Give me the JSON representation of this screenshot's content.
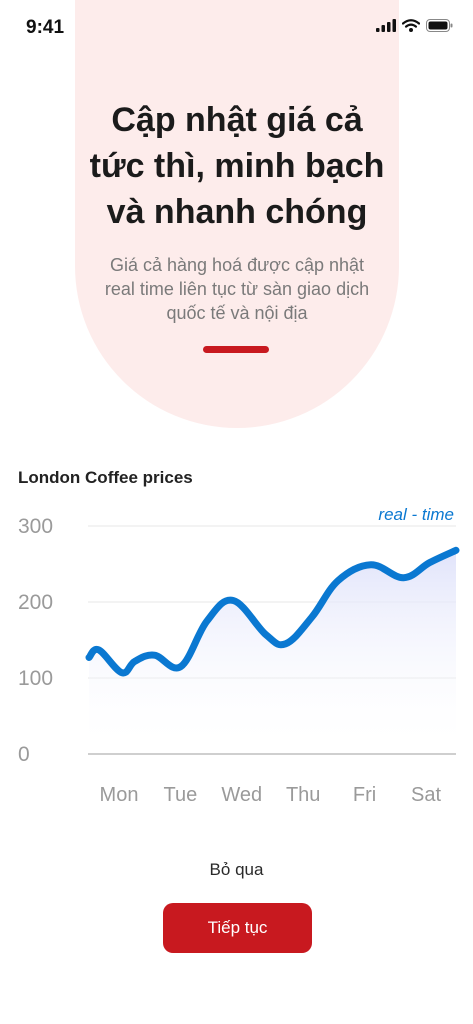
{
  "status_bar": {
    "time": "9:41",
    "icons": [
      "signal-icon",
      "wifi-icon",
      "battery-icon"
    ]
  },
  "onboarding": {
    "headline_lines": [
      "Cập nhật giá cả",
      "tức thì, minh bạch",
      "và nhanh chóng"
    ],
    "subtitle_lines": [
      "Giá cả hàng hoá được cập nhật",
      "real time liên tục từ sàn giao dịch",
      "quốc tế và nội địa"
    ],
    "page_indicator_color": "#c8191f"
  },
  "chart_section": {
    "title": "London Coffee prices",
    "realtime_label": "real - time"
  },
  "chart_data": {
    "type": "line",
    "title": "London Coffee prices",
    "categories": [
      "Mon",
      "Tue",
      "Wed",
      "Thu",
      "Fri",
      "Sat"
    ],
    "yticks": [
      0,
      100,
      200,
      300
    ],
    "ylim": [
      0,
      300
    ],
    "x": [
      0,
      0.15,
      0.5,
      0.7,
      1,
      1.4,
      1.8,
      2.2,
      2.7,
      3,
      3.4,
      3.8,
      4.3,
      4.8,
      5.2,
      5.6
    ],
    "values": [
      127,
      137,
      107,
      122,
      130,
      115,
      175,
      202,
      157,
      145,
      180,
      228,
      249,
      232,
      252,
      268
    ],
    "grid": "horizontal",
    "annotation": "real - time",
    "line_color": "#0a78d1",
    "fill_color": "#e6e8fb"
  },
  "actions": {
    "skip_label": "Bỏ qua",
    "continue_label": "Tiếp tục",
    "accent_color": "#c8191f"
  }
}
